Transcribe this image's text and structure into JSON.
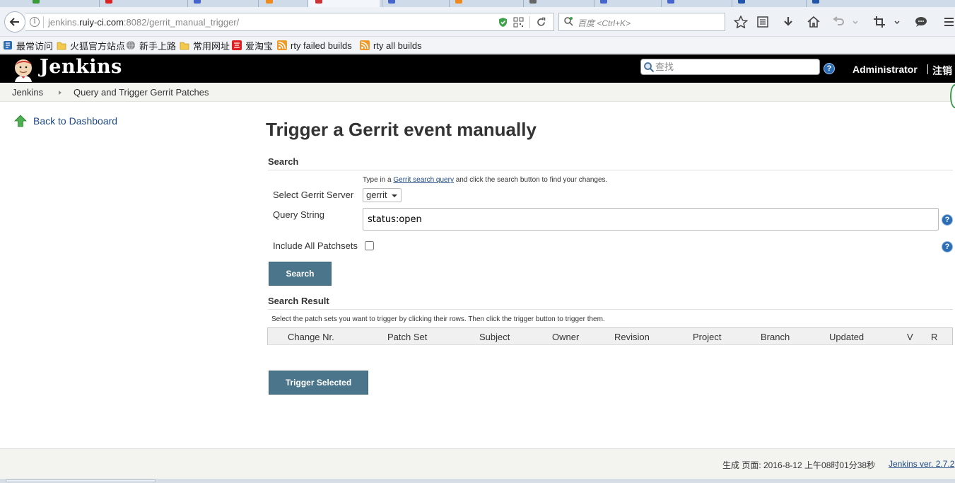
{
  "browser": {
    "url_prefix": "jenkins.",
    "url_host": "ruiy-ci.com",
    "url_rest": ":8082/gerrit_manual_trigger/",
    "search_placeholder": "百度 <Ctrl+K>",
    "bookmarks": [
      {
        "label": "最常访问",
        "icon": "bookmarks-icon"
      },
      {
        "label": "火狐官方站点",
        "icon": "folder-icon"
      },
      {
        "label": "新手上路",
        "icon": "globe-icon"
      },
      {
        "label": "常用网址",
        "icon": "folder-icon"
      },
      {
        "label": "爱淘宝",
        "icon": "taobao-icon"
      },
      {
        "label": "rty failed builds",
        "icon": "rss-icon"
      },
      {
        "label": "rty all builds",
        "icon": "rss-icon"
      }
    ]
  },
  "header": {
    "brand": "Jenkins",
    "search_placeholder": "查找",
    "user": "Administrator",
    "logout": "注销"
  },
  "breadcrumb": [
    "Jenkins",
    "Query and Trigger Gerrit Patches"
  ],
  "side": {
    "back_label": "Back to Dashboard"
  },
  "main": {
    "title": "Trigger a Gerrit event manually",
    "search_header": "Search",
    "hint_pre": "Type in a ",
    "hint_link": "Gerrit search query",
    "hint_post": " and click the search button to find your changes.",
    "server_label": "Select Gerrit Server",
    "server_value": "gerrit",
    "query_label": "Query String",
    "query_value": "status:open",
    "patchsets_label": "Include All Patchsets",
    "search_button": "Search",
    "result_header": "Search Result",
    "result_hint": "Select the patch sets you want to trigger by clicking their rows. Then click the trigger button to trigger them.",
    "columns": [
      "Change Nr.",
      "Patch Set",
      "Subject",
      "Owner",
      "Revision",
      "Project",
      "Branch",
      "Updated",
      "V",
      "R"
    ],
    "trigger_button": "Trigger Selected"
  },
  "footer": {
    "generated": "生成 页面: 2016-8-12 上午08时01分38秒",
    "version": "Jenkins ver. 2.7.2"
  },
  "colors": {
    "header_bg": "#000000",
    "button_bg": "#4b758b",
    "link": "#204a87",
    "breadcrumb_bg": "#f3f4ef"
  }
}
